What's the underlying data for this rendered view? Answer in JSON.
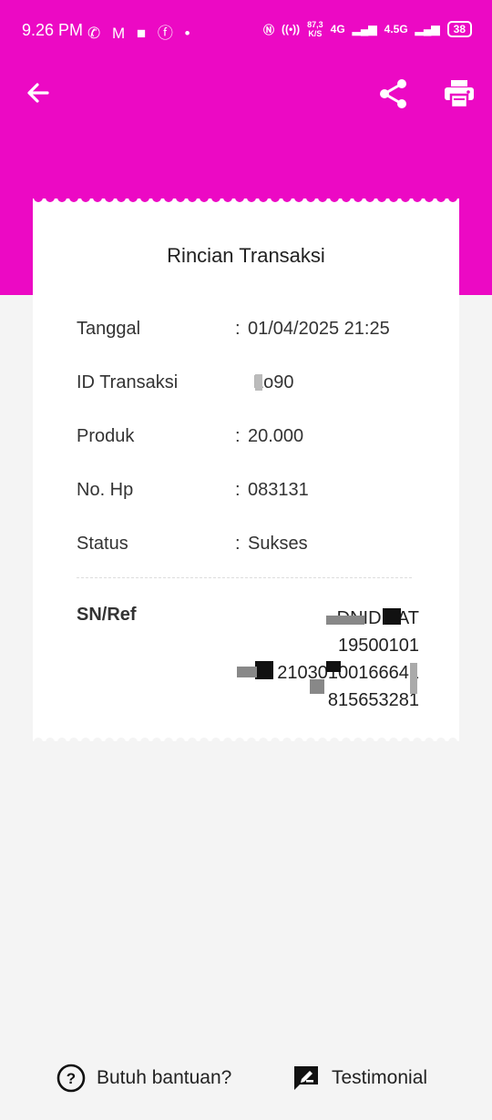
{
  "status_bar": {
    "time": "9.26 PM",
    "speed": "87,3",
    "speed_unit": "K/S",
    "net1": "4G",
    "net2": "4.5G",
    "battery": "38"
  },
  "toolbar": {
    "back_icon": "arrow-left-icon",
    "share_icon": "share-icon",
    "print_icon": "print-icon"
  },
  "receipt": {
    "title": "Rincian Transaksi",
    "rows": [
      {
        "label": "Tanggal",
        "colon": ":",
        "value": "01/04/2025 21:25"
      },
      {
        "label": "ID Transaksi",
        "colon": "",
        "value": "Lo90"
      },
      {
        "label": "Produk",
        "colon": ":",
        "value": "20.000"
      },
      {
        "label": "No. Hp",
        "colon": ":",
        "value": "083131"
      },
      {
        "label": "Status",
        "colon": ":",
        "value": "Sukses"
      }
    ],
    "sn_label": "SN/Ref",
    "sn_value": "DNID PAT\n19500101\n21030100166641\n815653281"
  },
  "footer": {
    "help_label": "Butuh bantuan?",
    "testimonial_label": "Testimonial"
  },
  "colors": {
    "brand": "#ec09c4",
    "background": "#f4f4f4"
  }
}
